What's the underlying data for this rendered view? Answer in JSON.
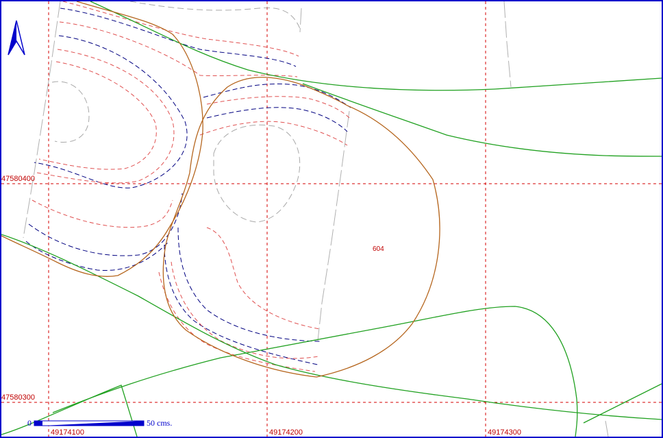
{
  "map": {
    "easting_labels": [
      "49174100",
      "49174200",
      "49174300"
    ],
    "northing_labels": [
      "47580400",
      "47580300"
    ],
    "parcel_number": "604",
    "scale_bar": {
      "start_label": "0",
      "end_label": "50 cms."
    },
    "north_arrow_icon": "north-arrow-icon",
    "colors": {
      "grid": "#d40000",
      "border": "#0000cc",
      "contour_blue": "#000080",
      "contour_red": "#e05050",
      "contour_gray": "#a8a8a8",
      "road": "#1fa01f",
      "parcel": "#b5651d"
    }
  }
}
